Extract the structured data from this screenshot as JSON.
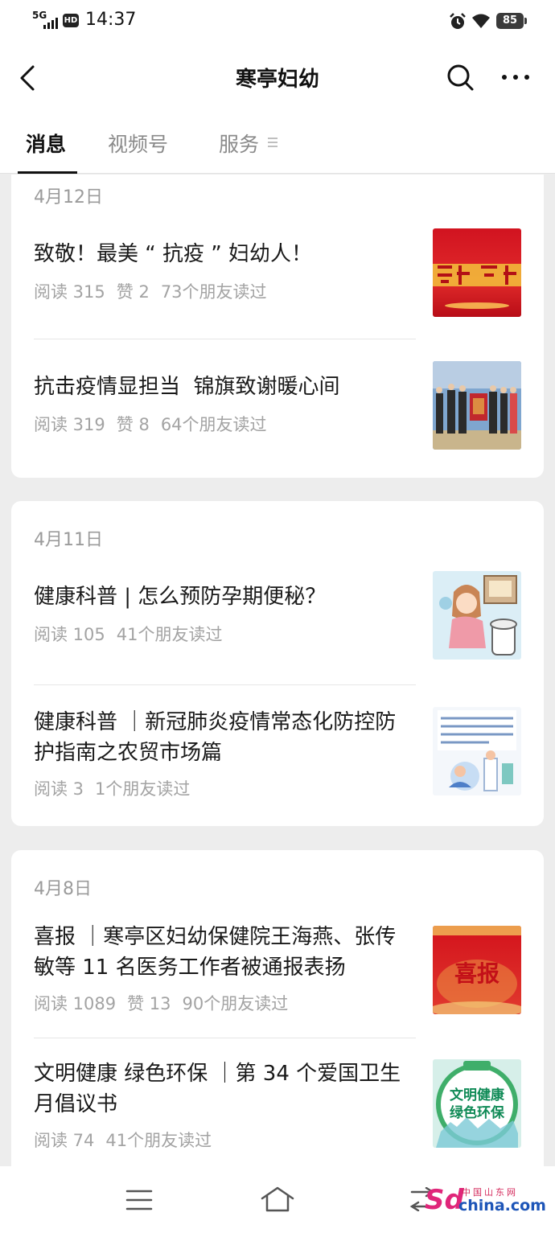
{
  "status_bar": {
    "network": "5G",
    "hd": "HD",
    "time": "14:37",
    "battery": "85"
  },
  "nav": {
    "title": "寒亭妇幼"
  },
  "tabs": [
    {
      "label": "消息",
      "active": true
    },
    {
      "label": "视频号",
      "active": false
    },
    {
      "label": "服务",
      "active": false
    }
  ],
  "groups": [
    {
      "date": "4月12日",
      "articles": [
        {
          "title": "致敬！最美 “ 抗疫 ” 妇幼人！",
          "reads": "阅读 315",
          "likes": "赞 2",
          "friends": "73个朋友读过",
          "thumb": "red-banner-image"
        },
        {
          "title": "抗击疫情显担当  锦旗致谢暖心间",
          "reads": "阅读 319",
          "likes": "赞 8",
          "friends": "64个朋友读过",
          "thumb": "group-photo-banner-image"
        }
      ]
    },
    {
      "date": "4月11日",
      "articles": [
        {
          "title": "健康科普 | 怎么预防孕期便秘？",
          "reads": "阅读 105",
          "likes": "",
          "friends": "41个朋友读过",
          "thumb": "cartoon-toilet-image"
        },
        {
          "title": "健康科普 ｜新冠肺炎疫情常态化防控防护指南之农贸市场篇",
          "reads": "阅读 3",
          "likes": "",
          "friends": "1个朋友读过",
          "thumb": "medical-illustration-image"
        }
      ]
    },
    {
      "date": "4月8日",
      "articles": [
        {
          "title": "喜报 ｜寒亭区妇幼保健院王海燕、张传敏等 11 名医务工作者被通报表扬",
          "reads": "阅读 1089",
          "likes": "赞 13",
          "friends": "90个朋友读过",
          "thumb": "good-news-poster-image",
          "thumb_text": "喜报"
        },
        {
          "title": "文明健康 绿色环保 ｜第 34 个爱国卫生月倡议书",
          "reads": "阅读 74",
          "likes": "",
          "friends": "41个朋友读过",
          "thumb": "green-health-badge-image",
          "thumb_text_1": "文明健康",
          "thumb_text_2": "绿色环保"
        }
      ]
    }
  ],
  "watermark": {
    "brand": "Sd",
    "region": "中国山东网",
    "domain": "china.com"
  },
  "colors": {
    "background": "#ededed",
    "card": "#ffffff",
    "meta_text": "#a3a3a3",
    "watermark_pink": "#e0267a",
    "watermark_blue": "#1d55b8"
  }
}
